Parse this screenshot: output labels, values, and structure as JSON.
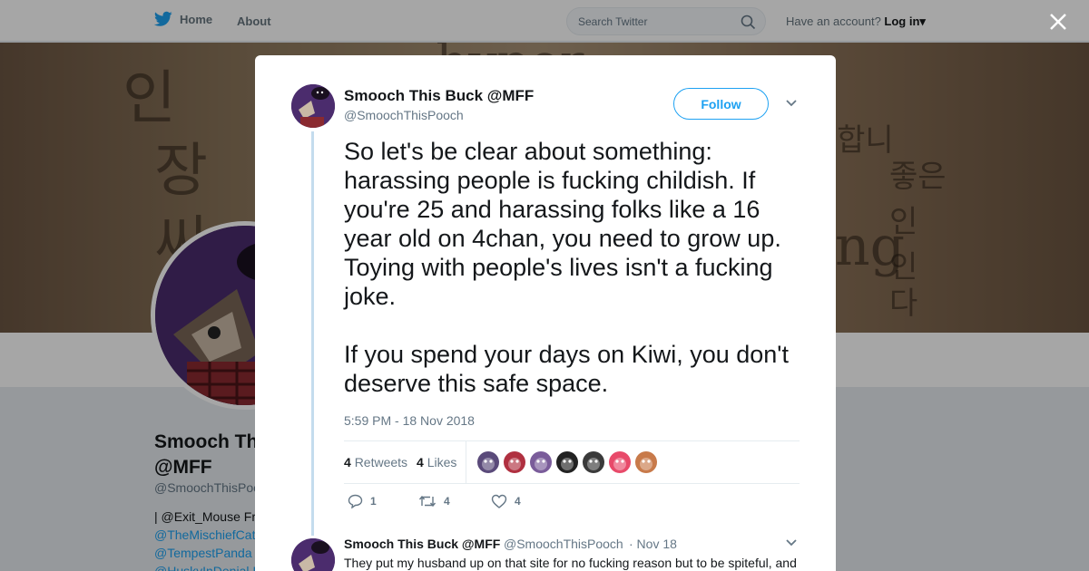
{
  "nav": {
    "home_label": "Home",
    "about_label": "About",
    "search_placeholder": "Search Twitter",
    "account_prompt": "Have an account?",
    "login_label": "Log in"
  },
  "background_profile": {
    "name_line1": "Smooch Th",
    "name_line2": "@MFF",
    "handle": "@SmoochThisPooc",
    "bio_lines": [
      "| @Exit_Mouse Fr",
      "@TheMischiefCat",
      "@TempestPanda",
      "@HuskyInDenial I"
    ]
  },
  "tweet": {
    "author_name": "Smooch This Buck @MFF",
    "author_handle": "@SmoochThisPooch",
    "follow_label": "Follow",
    "text": "So let's be clear about something: harassing people is fucking childish. If you're 25 and harassing folks like a 16 year old on 4chan, you need to grow up. Toying with people's lives isn't a fucking joke.\n\nIf you spend your days on Kiwi, you don't deserve this safe space.",
    "timestamp": "5:59 PM - 18 Nov 2018",
    "retweet_count": "4",
    "retweet_label": "Retweets",
    "like_count": "4",
    "like_label": "Likes",
    "reply_action_count": "1",
    "retweet_action_count": "4",
    "like_action_count": "4",
    "liker_avatar_colors": [
      "#5a4a7a",
      "#b03040",
      "#7a5c9a",
      "#222222",
      "#3a3a3a",
      "#e84a6a",
      "#c87a4a"
    ]
  },
  "reply": {
    "author_name": "Smooch This Buck @MFF",
    "author_handle": "@SmoochThisPooch",
    "date": "· Nov 18",
    "text": "They put my husband up on that site for no fucking reason but to be spiteful, and"
  },
  "colors": {
    "accent": "#1da1f2",
    "avatar_bg": "#4b2c6d"
  }
}
